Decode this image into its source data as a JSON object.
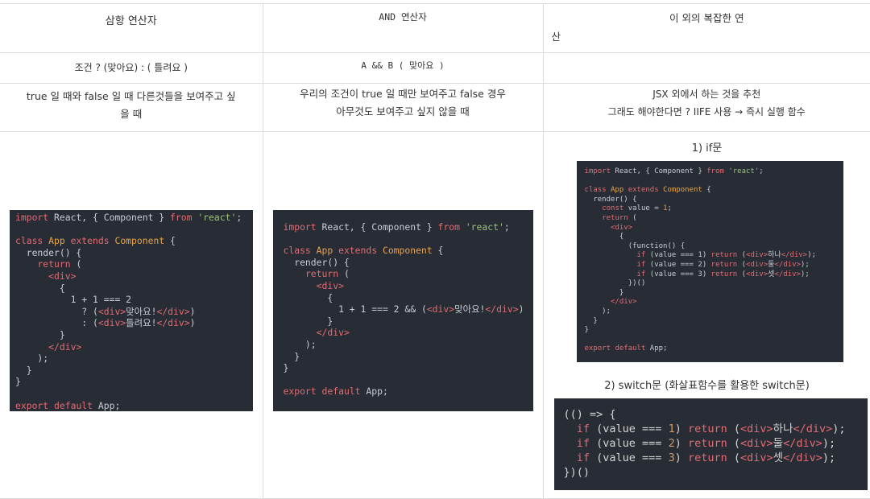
{
  "headers": {
    "col1": "삼항 연산자",
    "col2": "AND 연산자",
    "col3_line1": "이 외의 복잡한 연",
    "col3_line2": "산"
  },
  "syntax": {
    "col1": "조건 ? (맞아요) : ( 틀려요 )",
    "col2": "A && B ( 맞아요 )",
    "col3": ""
  },
  "usage": {
    "col1_line1": "true 일 때와 false 일 때 다른것들을 보여주고 싶",
    "col1_line2": "을 때",
    "col2_line1": "우리의 조건이 true 일 때만 보여주고 false 경우",
    "col2_line2": "아무것도 보여주고 싶지 않을 때",
    "col3_line1": "JSX 외에서 하는 것을 추천",
    "col3_line2": "그래도 해야한다면 ? IIFE 사용 → 즉시 실행 함수"
  },
  "captions": {
    "if_caption": "1) if문",
    "switch_caption": "2) switch문 (화살표함수를 활용한 switch문)"
  },
  "code": {
    "common": {
      "import_kw": "import",
      "import_names": " React, { Component } ",
      "from_kw": "from",
      "react_str": "'react'",
      "semicolon": ";",
      "class_kw": "class",
      "app_name": "App",
      "extends_kw": "extends",
      "component_name": "Component",
      "open_brace": " {",
      "render_line": "  render() {",
      "return_kw": "return",
      "div_open": "<div>",
      "div_close": "</div>",
      "brace_open": "{",
      "brace_close": "}",
      "export_kw": "export",
      "default_kw": "default",
      "export_tail": " App;"
    },
    "ternary": {
      "cond": "1 + 1 === 2",
      "q": "? (",
      "yes": "맞아요!",
      "colon": ": (",
      "no": "틀려요!"
    },
    "and": {
      "cond": "1 + 1 === 2 && (",
      "yes": "맞아요!"
    },
    "iife": {
      "const_kw": "const",
      "value_assign": " value = ",
      "value_num": "1",
      "fn_open": "(function() {",
      "if_kw": "if",
      "cond_prefix": " (value === ",
      "cond_suffix": ") ",
      "items": [
        "하나",
        "둘",
        "셋"
      ],
      "nums": [
        "1",
        "2",
        "3"
      ],
      "fn_close": "})()"
    },
    "arrow": {
      "open": "(() => {",
      "close": "})()"
    }
  }
}
